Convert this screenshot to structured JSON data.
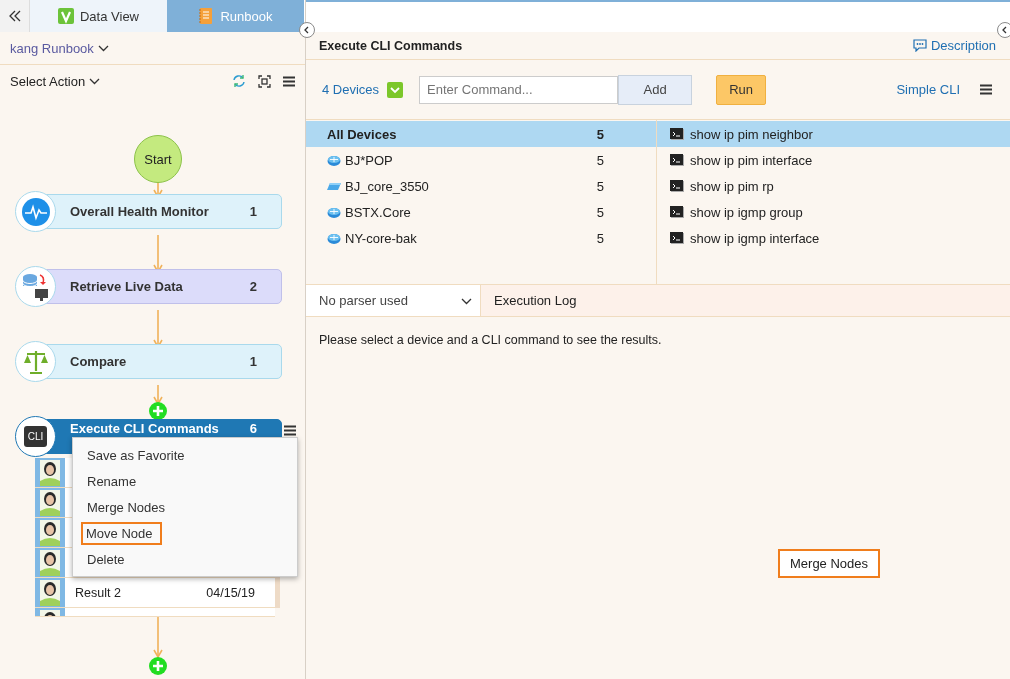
{
  "tabs": [
    {
      "label": "Data View",
      "kind": "dataview",
      "selected": false
    },
    {
      "label": "Runbook",
      "kind": "runbook",
      "selected": true
    }
  ],
  "runbook_selector": {
    "label": "kang Runbook"
  },
  "action_selector": {
    "label": "Select Action"
  },
  "flow": {
    "start_label": "Start",
    "nodes": [
      {
        "kind": "health",
        "title": "Overall Health Monitor",
        "count": "1",
        "selected": false
      },
      {
        "kind": "retrieve",
        "title": "Retrieve Live Data",
        "count": "2",
        "selected": false
      },
      {
        "kind": "compare",
        "title": "Compare",
        "count": "1",
        "selected": false
      },
      {
        "kind": "cli",
        "title": "Execute CLI Commands",
        "count": "6",
        "selected": true,
        "icon_label": "CLI"
      }
    ],
    "results": [
      {
        "kind": "covered"
      },
      {
        "kind": "covered"
      },
      {
        "kind": "covered"
      },
      {
        "kind": "covered"
      },
      {
        "kind": "shown",
        "name": "Result 2",
        "date": "04/15/19"
      },
      {
        "kind": "cut"
      }
    ]
  },
  "context_menu": {
    "items": [
      {
        "label": "Save as Favorite",
        "highlighted": false
      },
      {
        "label": "Rename",
        "highlighted": false
      },
      {
        "label": "Merge Nodes",
        "highlighted": false
      },
      {
        "label": "Move Node",
        "highlighted": true
      },
      {
        "label": "Delete",
        "highlighted": false
      }
    ]
  },
  "panel": {
    "title": "Execute CLI Commands",
    "description_link": "Description",
    "devices_link": "4 Devices",
    "command_field": {
      "placeholder": "Enter Command..."
    },
    "add_button": "Add",
    "run_button": "Run",
    "mode_link": "Simple CLI"
  },
  "devices": [
    {
      "kind": "all",
      "name": "All Devices",
      "count": "5",
      "selected": true
    },
    {
      "kind": "router",
      "name": "BJ*POP",
      "count": "5",
      "selected": false
    },
    {
      "kind": "switch",
      "name": "BJ_core_3550",
      "count": "5",
      "selected": false
    },
    {
      "kind": "router",
      "name": "BSTX.Core",
      "count": "5",
      "selected": false
    },
    {
      "kind": "router",
      "name": "NY-core-bak",
      "count": "5",
      "selected": false
    }
  ],
  "commands": [
    {
      "text": "show ip pim neighbor",
      "selected": true
    },
    {
      "text": "show ip pim interface",
      "selected": false
    },
    {
      "text": "show ip pim rp",
      "selected": false
    },
    {
      "text": "show ip igmp group",
      "selected": false
    },
    {
      "text": "show ip igmp interface",
      "selected": false
    }
  ],
  "parser_select": {
    "value": "No parser used"
  },
  "log_tab": "Execution Log",
  "message": "Please select a device and a CLI command to see the results.",
  "callout": "Merge Nodes"
}
